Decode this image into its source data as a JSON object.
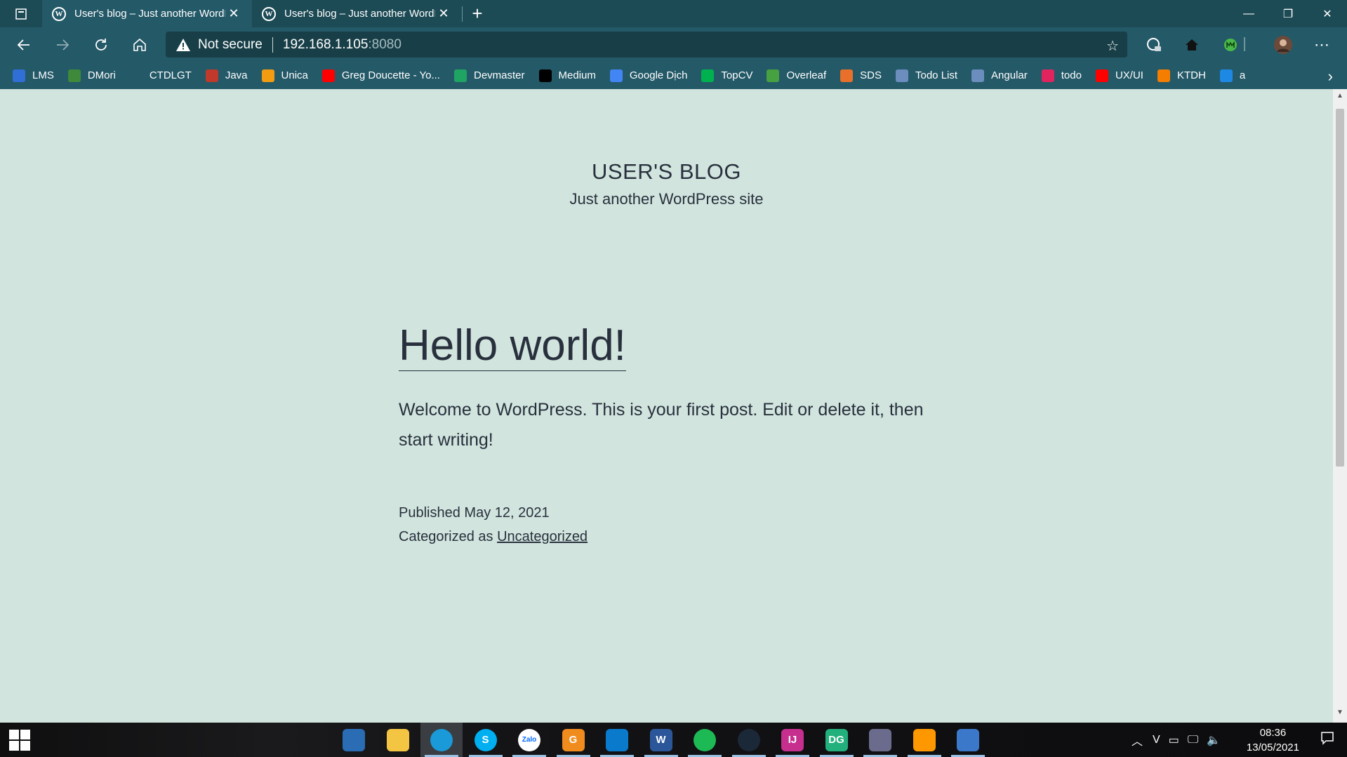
{
  "browser": {
    "tabs": [
      {
        "title": "User's blog – Just another WordPress site",
        "active": true
      },
      {
        "title": "User's blog – Just another WordPress site",
        "active": false
      }
    ],
    "address": {
      "security_label": "Not secure",
      "host": "192.168.1.105",
      "port": ":8080"
    }
  },
  "bookmarks": [
    {
      "label": "LMS",
      "icon": "lms-icon",
      "color": "#2f6fd6"
    },
    {
      "label": "DMori",
      "icon": "dmori-icon",
      "color": "#3e8a3a"
    },
    {
      "label": "CTDLGT",
      "icon": "page-icon",
      "color": "#245968"
    },
    {
      "label": "Java",
      "icon": "java-icon",
      "color": "#c0392b"
    },
    {
      "label": "Unica",
      "icon": "unica-icon",
      "color": "#f39c12"
    },
    {
      "label": "Greg Doucette - Yo...",
      "icon": "youtube-icon",
      "color": "#ff0000"
    },
    {
      "label": "Devmaster",
      "icon": "drive-icon",
      "color": "#1fa463"
    },
    {
      "label": "Medium",
      "icon": "medium-icon",
      "color": "#000000"
    },
    {
      "label": "Google Dịch",
      "icon": "translate-icon",
      "color": "#4285f4"
    },
    {
      "label": "TopCV",
      "icon": "topcv-icon",
      "color": "#00b14f"
    },
    {
      "label": "Overleaf",
      "icon": "overleaf-icon",
      "color": "#47a141"
    },
    {
      "label": "SDS",
      "icon": "sds-icon",
      "color": "#e8702a"
    },
    {
      "label": "Todo List",
      "icon": "vue-icon",
      "color": "#6c8ebf"
    },
    {
      "label": "Angular",
      "icon": "vue-icon",
      "color": "#6c8ebf"
    },
    {
      "label": "todo",
      "icon": "heart-icon",
      "color": "#e0245e"
    },
    {
      "label": "UX/UI",
      "icon": "youtube-icon",
      "color": "#ff0000"
    },
    {
      "label": "KTDH",
      "icon": "blogger-icon",
      "color": "#f57d00"
    },
    {
      "label": "a",
      "icon": "refresh-icon",
      "color": "#1e88e5"
    }
  ],
  "page": {
    "site_title": "USER'S BLOG",
    "site_description": "Just another WordPress site",
    "post_title": "Hello world!",
    "post_body": "Welcome to WordPress. This is your first post. Edit or delete it, then start writing!",
    "published_prefix": "Published",
    "published_date": "May 12, 2021",
    "category_prefix": "Categorized as",
    "category": "Uncategorized"
  },
  "taskbar": {
    "time": "08:36",
    "date": "13/05/2021",
    "apps": [
      {
        "name": "desktop",
        "label": "",
        "color": "#2a6db5"
      },
      {
        "name": "file-explorer",
        "label": "",
        "color": "#f4c542"
      },
      {
        "name": "edge",
        "label": "",
        "color": "#1a9ad8"
      },
      {
        "name": "skype",
        "label": "S",
        "color": "#00aff0"
      },
      {
        "name": "zalo",
        "label": "Zalo",
        "color": "#ffffff"
      },
      {
        "name": "foxit",
        "label": "G",
        "color": "#f08c1e"
      },
      {
        "name": "vscode",
        "label": "",
        "color": "#0a7acc"
      },
      {
        "name": "word",
        "label": "W",
        "color": "#2b579a"
      },
      {
        "name": "spotify",
        "label": "",
        "color": "#1db954"
      },
      {
        "name": "steam",
        "label": "",
        "color": "#1b2838"
      },
      {
        "name": "intellij",
        "label": "IJ",
        "color": "#c62f8e"
      },
      {
        "name": "datagrip",
        "label": "DG",
        "color": "#22b07d"
      },
      {
        "name": "virtualbox",
        "label": "",
        "color": "#6b6b8e"
      },
      {
        "name": "sublime",
        "label": "",
        "color": "#ff9800"
      },
      {
        "name": "remote",
        "label": "",
        "color": "#3b78c9"
      }
    ]
  }
}
